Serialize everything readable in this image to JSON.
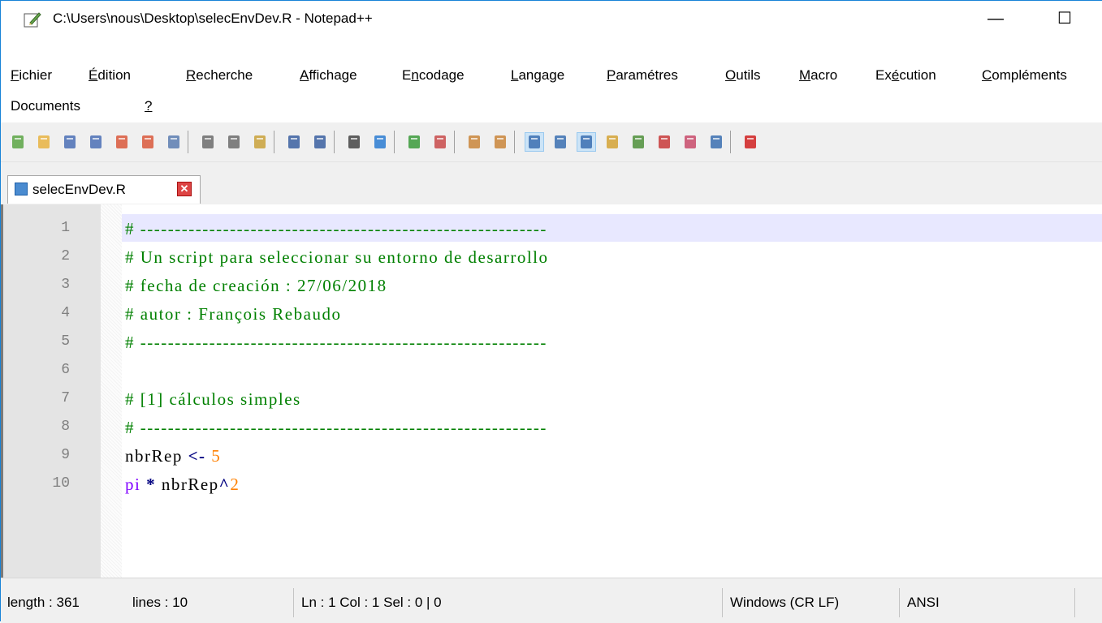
{
  "window": {
    "title": "C:\\Users\\nous\\Desktop\\selecEnvDev.R - Notepad++",
    "minimize_glyph": "—",
    "maximize_glyph": "☐"
  },
  "menu": {
    "row1": [
      {
        "pre": "",
        "u": "F",
        "post": "ichier"
      },
      {
        "pre": "",
        "u": "É",
        "post": "dition"
      },
      {
        "pre": "",
        "u": "R",
        "post": "echerche"
      },
      {
        "pre": "",
        "u": "A",
        "post": "ffichage"
      },
      {
        "pre": "E",
        "u": "n",
        "post": "codage"
      },
      {
        "pre": "",
        "u": "L",
        "post": "angage"
      },
      {
        "pre": "",
        "u": "P",
        "post": "aramétres"
      },
      {
        "pre": "",
        "u": "O",
        "post": "utils"
      },
      {
        "pre": "",
        "u": "M",
        "post": "acro"
      },
      {
        "pre": "Ex",
        "u": "é",
        "post": "cution"
      },
      {
        "pre": "",
        "u": "C",
        "post": "ompléments"
      }
    ],
    "row2": [
      {
        "pre": "Documents",
        "u": "",
        "post": ""
      },
      {
        "pre": "",
        "u": "?",
        "post": ""
      }
    ]
  },
  "toolbar_icons": [
    "new-file-icon",
    "open-file-icon",
    "save-icon",
    "save-all-icon",
    "close-icon",
    "close-all-icon",
    "print-icon",
    "cut-icon",
    "copy-icon",
    "paste-icon",
    "undo-icon",
    "redo-icon",
    "find-icon",
    "replace-icon",
    "zoom-in-icon",
    "zoom-out-icon",
    "sync-vertical-icon",
    "sync-horizontal-icon",
    "word-wrap-icon",
    "show-all-chars-icon",
    "indent-guide-icon",
    "udl-icon",
    "doc-map-icon",
    "function-list-icon",
    "folder-workspace-icon",
    "monitoring-icon",
    "record-macro-icon"
  ],
  "tab": {
    "label": "selecEnvDev.R",
    "close_glyph": "✕"
  },
  "editor": {
    "lines": [
      {
        "n": "1",
        "tokens": [
          {
            "t": "# -----------------------------------------------------------",
            "c": "c-comment"
          }
        ]
      },
      {
        "n": "2",
        "tokens": [
          {
            "t": "# Un script para seleccionar su entorno de desarrollo",
            "c": "c-comment"
          }
        ]
      },
      {
        "n": "3",
        "tokens": [
          {
            "t": "# fecha de creación : 27/06/2018",
            "c": "c-comment"
          }
        ]
      },
      {
        "n": "4",
        "tokens": [
          {
            "t": "# autor : François Rebaudo",
            "c": "c-comment"
          }
        ]
      },
      {
        "n": "5",
        "tokens": [
          {
            "t": "# -----------------------------------------------------------",
            "c": "c-comment"
          }
        ]
      },
      {
        "n": "6",
        "tokens": []
      },
      {
        "n": "7",
        "tokens": [
          {
            "t": "# [1] cálculos simples",
            "c": "c-comment"
          }
        ]
      },
      {
        "n": "8",
        "tokens": [
          {
            "t": "# -----------------------------------------------------------",
            "c": "c-comment"
          }
        ]
      },
      {
        "n": "9",
        "tokens": [
          {
            "t": "nbrRep ",
            "c": "c-ident"
          },
          {
            "t": "<-",
            "c": "c-op"
          },
          {
            "t": " ",
            "c": "c-ident"
          },
          {
            "t": "5",
            "c": "c-num"
          }
        ]
      },
      {
        "n": "10",
        "tokens": [
          {
            "t": "pi",
            "c": "c-kw"
          },
          {
            "t": " ",
            "c": "c-ident"
          },
          {
            "t": "*",
            "c": "c-op"
          },
          {
            "t": " nbrRep",
            "c": "c-ident"
          },
          {
            "t": "^",
            "c": "c-op"
          },
          {
            "t": "2",
            "c": "c-num"
          }
        ]
      }
    ]
  },
  "status": {
    "length": "length : 361",
    "lines": "lines : 10",
    "position": "Ln : 1    Col : 1    Sel : 0 | 0",
    "eol": "Windows (CR LF)",
    "encoding": "ANSI"
  }
}
